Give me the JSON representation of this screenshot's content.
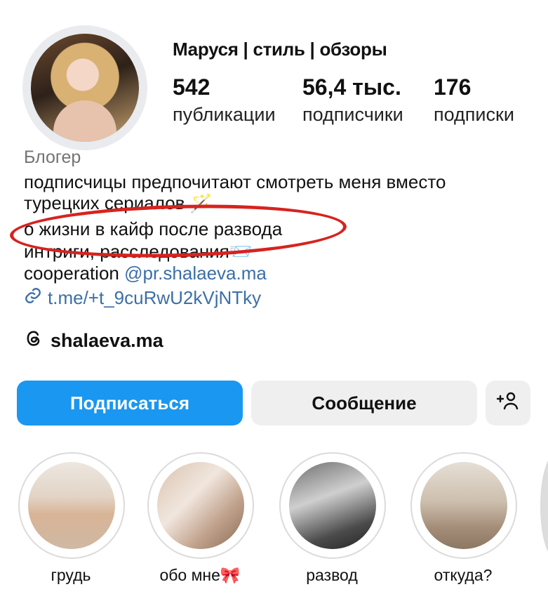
{
  "profile": {
    "username": "Маруся | стиль | обзоры",
    "stats": [
      {
        "value": "542",
        "label": "публикации"
      },
      {
        "value": "56,4 тыс.",
        "label": "подписчики"
      },
      {
        "value": "176",
        "label": "подписки"
      }
    ],
    "category": "Блогер",
    "bio": {
      "line1": "подписчицы предпочитают смотреть меня вместо",
      "line2": "турецких сериалов 🪄",
      "line3": "о жизни в кайф после развода",
      "line4": "интриги, расследования📨",
      "line5_prefix": "cooperation ",
      "line5_mention": "@pr.shalaeva.ma"
    },
    "link": "t.me/+t_9cuRwU2kVjNTky",
    "threads_handle": "shalaeva.ma"
  },
  "actions": {
    "follow": "Подписаться",
    "message": "Сообщение",
    "add_person_icon": "+👤"
  },
  "highlights": [
    {
      "label": "грудь"
    },
    {
      "label": "обо мне🎀"
    },
    {
      "label": "развод"
    },
    {
      "label": "откуда?"
    }
  ],
  "colors": {
    "follow_button": "#1a97f0",
    "link": "#3b6fa8",
    "annotation_circle": "#d6231f"
  },
  "icons": {
    "link": "link-icon",
    "threads": "threads-icon",
    "add_person": "add-person-icon"
  }
}
